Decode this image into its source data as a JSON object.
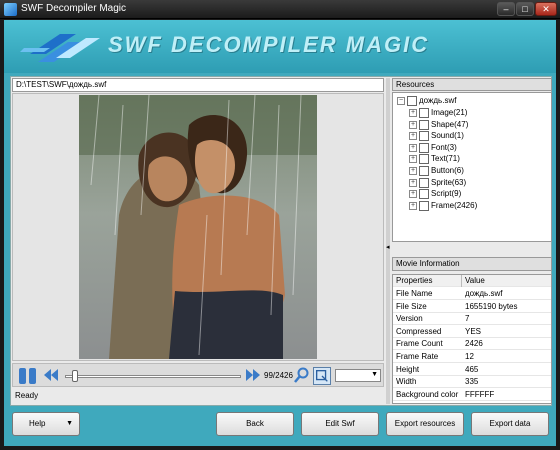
{
  "window": {
    "title": "SWF Decompiler Magic"
  },
  "window_buttons": {
    "minimize": "–",
    "maximize": "□",
    "close": "✕"
  },
  "banner": {
    "title": "SWF DECOMPILER MAGIC"
  },
  "path": "D:\\TEST\\SWF\\дождь.swf",
  "player": {
    "frame_counter": "99/2426",
    "zoom_value": "",
    "position_fraction": 0.04
  },
  "status": "Ready",
  "resources": {
    "header": "Resources",
    "root": "дождь.swf",
    "items": [
      {
        "label": "Image(21)"
      },
      {
        "label": "Shape(47)"
      },
      {
        "label": "Sound(1)"
      },
      {
        "label": "Font(3)"
      },
      {
        "label": "Text(71)"
      },
      {
        "label": "Button(6)"
      },
      {
        "label": "Sprite(63)"
      },
      {
        "label": "Script(9)"
      },
      {
        "label": "Frame(2426)"
      }
    ]
  },
  "movie_info": {
    "header": "Movie Information",
    "columns": {
      "key": "Properties",
      "value": "Value"
    },
    "rows": [
      {
        "k": "File Name",
        "v": "дождь.swf"
      },
      {
        "k": "File Size",
        "v": "1655190 bytes"
      },
      {
        "k": "Version",
        "v": "7"
      },
      {
        "k": "Compressed",
        "v": "YES"
      },
      {
        "k": "Frame Count",
        "v": "2426"
      },
      {
        "k": "Frame Rate",
        "v": "12"
      },
      {
        "k": "Height",
        "v": "465"
      },
      {
        "k": "Width",
        "v": "335"
      },
      {
        "k": "Background color",
        "v": "FFFFFF"
      }
    ]
  },
  "buttons": {
    "help": "Help",
    "back": "Back",
    "edit": "Edit Swf",
    "export_resources": "Export resources",
    "export_data": "Export data"
  },
  "icons": {
    "pause": "pause-icon",
    "rewind": "rewind-icon",
    "forward": "forward-icon",
    "zoom": "magnifier-icon",
    "fit": "fit-icon"
  }
}
